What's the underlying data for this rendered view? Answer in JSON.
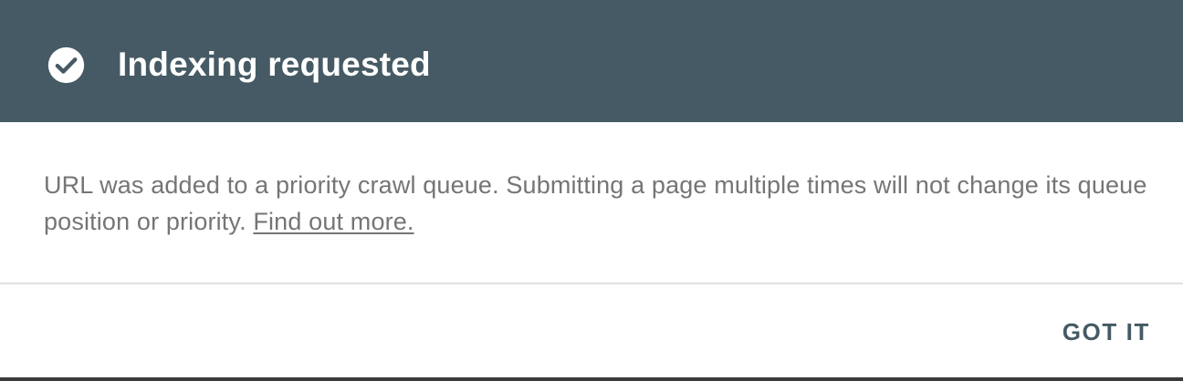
{
  "dialog": {
    "title": "Indexing requested",
    "title_icon": "check-circle-icon",
    "message": "URL was added to a priority crawl queue. Submitting a page multiple times will not change its queue position or priority.",
    "link_text": "Find out more.",
    "confirm_label": "GOT IT"
  },
  "colors": {
    "header_background": "#455a64",
    "header_text": "#ffffff",
    "body_text": "#757575",
    "button_text": "#455a64",
    "divider": "#e0e0e0"
  }
}
